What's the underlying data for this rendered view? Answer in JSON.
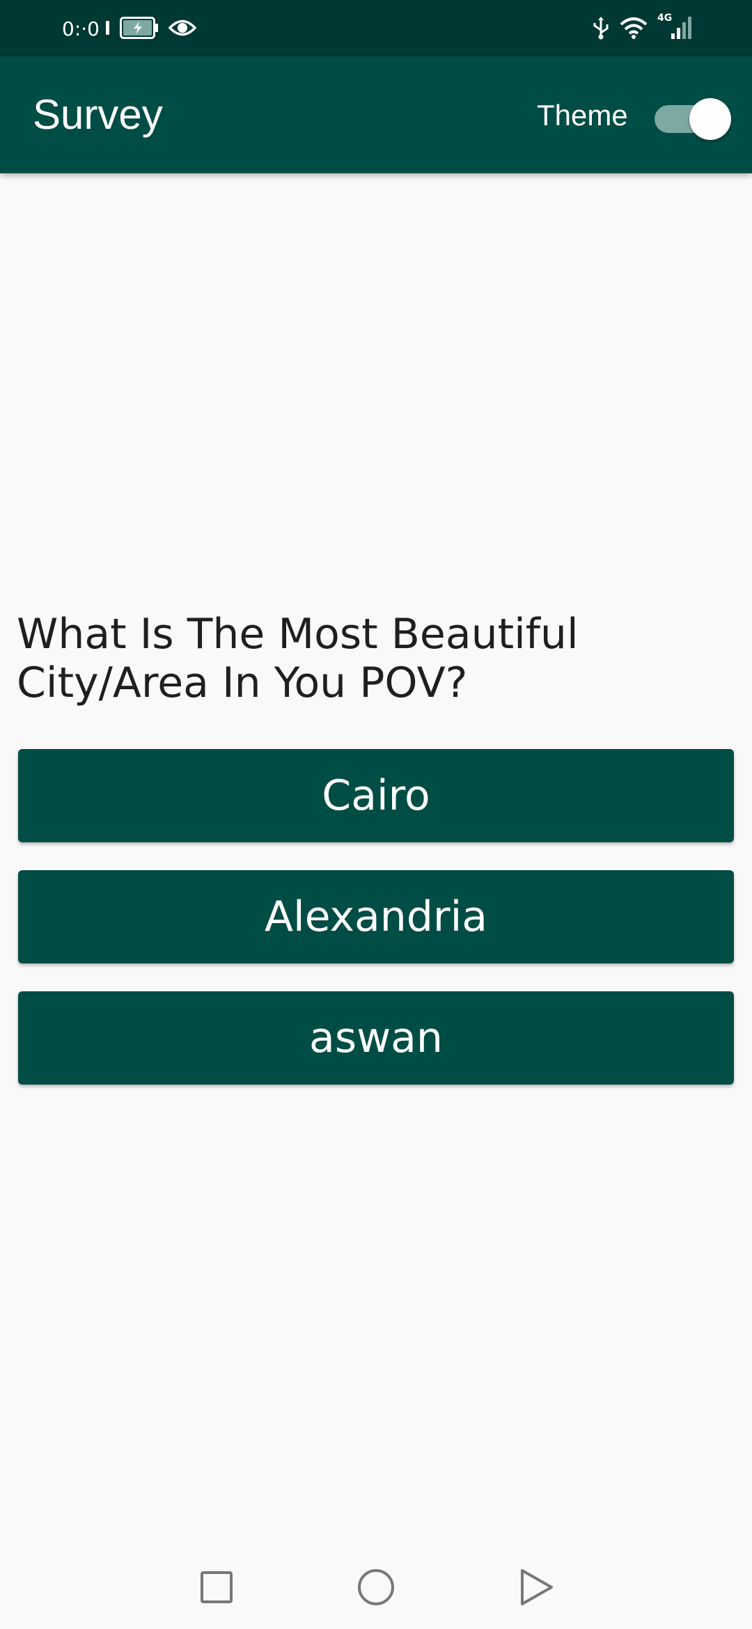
{
  "status_bar": {
    "time": "0:·0",
    "icons": [
      "sim-card-icon",
      "battery-charging-icon",
      "eye-icon",
      "usb-icon",
      "wifi-icon",
      "signal-4g-icon"
    ],
    "network_label": "4G"
  },
  "app_bar": {
    "title": "Survey",
    "theme_label": "Theme",
    "theme_switch_on": true
  },
  "survey": {
    "question": "What Is The Most Beautiful City/Area In You POV?",
    "answers": [
      {
        "label": "Cairo"
      },
      {
        "label": "Alexandria"
      },
      {
        "label": "aswan"
      }
    ]
  },
  "nav_bar": {
    "buttons": [
      "recents-square-icon",
      "home-circle-icon",
      "back-triangle-icon"
    ]
  },
  "colors": {
    "status_bar": "#003834",
    "primary": "#004d45",
    "background": "#f9f9f9",
    "switch_track": "#7ea8a3",
    "text_dark": "#1f1f1f",
    "on_primary": "#ffffff"
  }
}
